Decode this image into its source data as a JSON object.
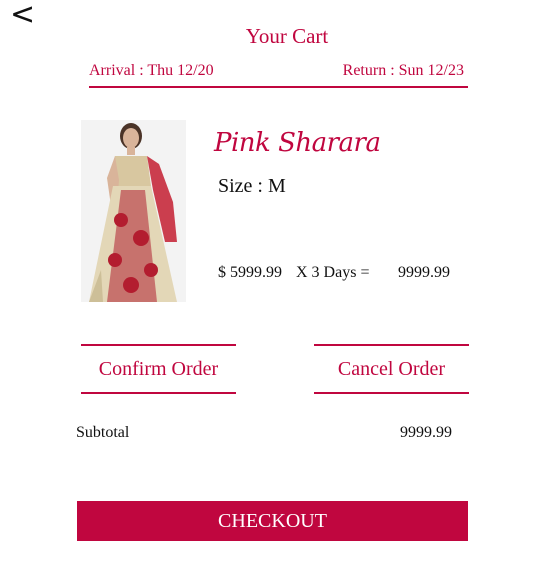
{
  "nav": {
    "back_glyph": "<"
  },
  "header": {
    "title": "Your Cart"
  },
  "dates": {
    "arrival": "Arrival : Thu 12/20",
    "return": "Return : Sun 12/23"
  },
  "item": {
    "name": "Pink Sharara",
    "size": "Size : M",
    "price": "$ 5999.99",
    "days": "X 3 Days =",
    "total": "9999.99",
    "image_icon": "dress-photo"
  },
  "actions": {
    "confirm_label": "Confirm Order",
    "cancel_label": "Cancel Order"
  },
  "summary": {
    "subtotal_label": "Subtotal",
    "subtotal_value": "9999.99"
  },
  "checkout": {
    "label": "CHECKOUT"
  },
  "colors": {
    "accent": "#c0063f",
    "text": "#111111",
    "background": "#ffffff"
  }
}
